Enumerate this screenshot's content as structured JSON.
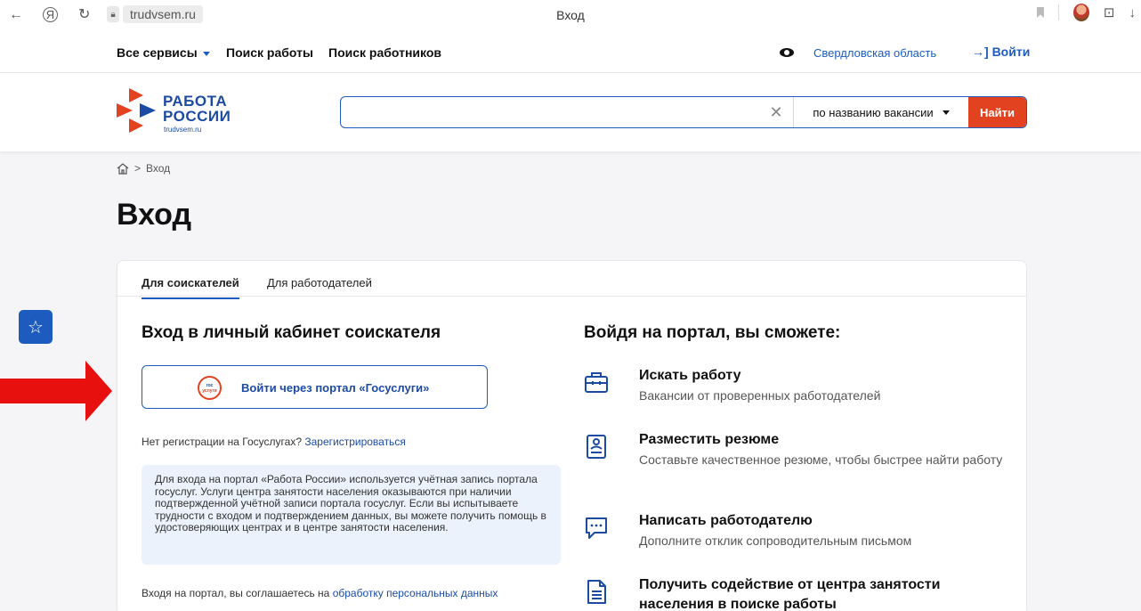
{
  "browser": {
    "domain": "trudvsem.ru",
    "tab_title": "Вход"
  },
  "topnav": {
    "all_services": "Все сервисы",
    "job_search": "Поиск работы",
    "worker_search": "Поиск работников",
    "region": "Свердловская область",
    "login": "Войти"
  },
  "header": {
    "logo_line1": "РАБОТА",
    "logo_line2": "РОССИИ",
    "logo_sub": "trudvsem.ru",
    "search_value": "",
    "search_mode": "по названию вакансии",
    "search_button": "Найти"
  },
  "breadcrumb": {
    "current": "Вход"
  },
  "page": {
    "title": "Вход"
  },
  "tabs": [
    {
      "label": "Для соискателей",
      "active": true
    },
    {
      "label": "Для работодателей",
      "active": false
    }
  ],
  "left": {
    "title": "Вход в личный кабинет соискателя",
    "gos_logo_top": "гос",
    "gos_logo_bottom": "услуги",
    "gos_button": "Войти через портал «Госуслуги»",
    "noreg_text": "Нет регистрации на Госуслугах?",
    "noreg_link": "Зарегистрироваться",
    "info_text": "Для входа на портал «Работа России» используется учётная запись портала госуслуг. Услуги центра занятости населения оказываются при наличии подтвержденной учётной записи портала госуслуг. Если вы испытываете трудности с входом и подтверждением данных, вы можете получить помощь в удостоверяющих центрах и в центре занятости населения.",
    "agree_text": "Входя на портал, вы соглашаетесь на",
    "agree_link": "обработку персональных данных"
  },
  "right": {
    "title": "Войдя на портал, вы сможете:",
    "features": [
      {
        "icon": "briefcase-icon",
        "title": "Искать работу",
        "desc": "Вакансии от проверенных работодателей"
      },
      {
        "icon": "resume-icon",
        "title": "Разместить резюме",
        "desc": "Составьте качественное резюме, чтобы быстрее найти работу"
      },
      {
        "icon": "message-icon",
        "title": "Написать работодателю",
        "desc": "Дополните отклик сопроводительным письмом"
      },
      {
        "icon": "document-icon",
        "title": "Получить содействие от центра занятости населения в поиске работы",
        "desc": ""
      }
    ]
  },
  "colors": {
    "accent": "#1d5cbe",
    "brand": "#1d4ba3",
    "search_button": "#e2421f",
    "arrow": "#e8100e",
    "info_bg": "#ebf2fb"
  }
}
